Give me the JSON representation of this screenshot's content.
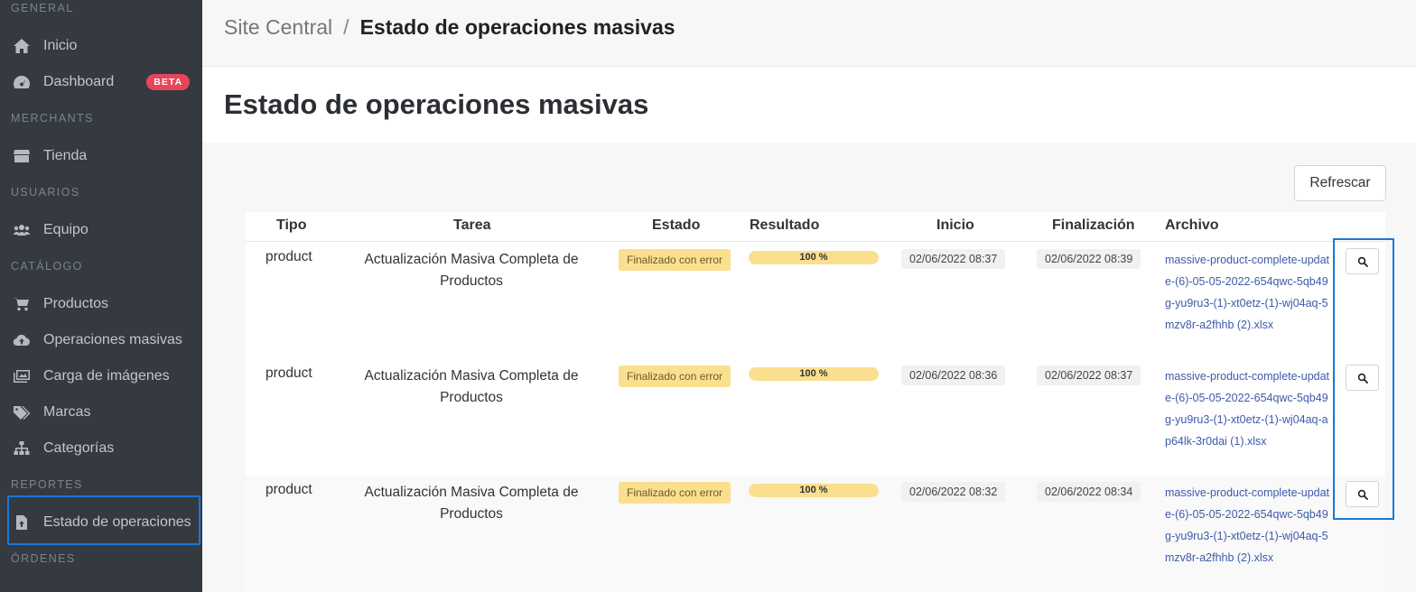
{
  "sidebar": {
    "sections": {
      "general": "GENERAL",
      "merchants": "MERCHANTS",
      "usuarios": "USUARIOS",
      "catalogo": "CATÁLOGO",
      "reportes": "REPORTES",
      "ordenes": "ÓRDENES"
    },
    "items": {
      "inicio": {
        "label": "Inicio",
        "icon": "home-icon"
      },
      "dashboard": {
        "label": "Dashboard",
        "icon": "dashboard-icon",
        "badge": "BETA"
      },
      "tienda": {
        "label": "Tienda",
        "icon": "store-icon"
      },
      "equipo": {
        "label": "Equipo",
        "icon": "users-icon"
      },
      "productos": {
        "label": "Productos",
        "icon": "cart-icon"
      },
      "operaciones": {
        "label": "Operaciones masivas",
        "icon": "cloud-upload-icon"
      },
      "imagenes": {
        "label": "Carga de imágenes",
        "icon": "images-icon"
      },
      "marcas": {
        "label": "Marcas",
        "icon": "tags-icon"
      },
      "categorias": {
        "label": "Categorías",
        "icon": "sitemap-icon"
      },
      "estado": {
        "label": "Estado de operaciones",
        "icon": "file-upload-icon",
        "active": true
      }
    },
    "colors": {
      "background": "#343a40",
      "badge": "#e8455a",
      "highlight": "#1878d6"
    }
  },
  "breadcrumb": {
    "root": "Site Central",
    "separator": "/",
    "current": "Estado de operaciones masivas"
  },
  "page": {
    "title": "Estado de operaciones masivas",
    "refresh_label": "Refrescar"
  },
  "table": {
    "headers": {
      "tipo": "Tipo",
      "tarea": "Tarea",
      "estado": "Estado",
      "resultado": "Resultado",
      "inicio": "Inicio",
      "fin": "Finalización",
      "archivo": "Archivo"
    },
    "rows": [
      {
        "tipo": "product",
        "tarea": "Actualización Masiva Completa de Productos",
        "estado": "Finalizado con error",
        "resultado": "100 %",
        "progress": 100,
        "inicio": "02/06/2022 08:37",
        "fin": "02/06/2022 08:39",
        "archivo": "massive-product-complete-update-(6)-05-05-2022-654qwc-5qb49g-yu9ru3-(1)-xt0etz-(1)-wj04aq-5mzv8r-a2fhhb (2).xlsx"
      },
      {
        "tipo": "product",
        "tarea": "Actualización Masiva Completa de Productos",
        "estado": "Finalizado con error",
        "resultado": "100 %",
        "progress": 100,
        "inicio": "02/06/2022 08:36",
        "fin": "02/06/2022 08:37",
        "archivo": "massive-product-complete-update-(6)-05-05-2022-654qwc-5qb49g-yu9ru3-(1)-xt0etz-(1)-wj04aq-ap64lk-3r0dai (1).xlsx"
      },
      {
        "tipo": "product",
        "tarea": "Actualización Masiva Completa de Productos",
        "estado": "Finalizado con error",
        "resultado": "100 %",
        "progress": 100,
        "inicio": "02/06/2022 08:32",
        "fin": "02/06/2022 08:34",
        "archivo": "massive-product-complete-update-(6)-05-05-2022-654qwc-5qb49g-yu9ru3-(1)-xt0etz-(1)-wj04aq-5mzv8r-a2fhhb (2).xlsx"
      }
    ],
    "colors": {
      "status_badge": "#fadf8e",
      "link": "#3d5ba9"
    }
  }
}
